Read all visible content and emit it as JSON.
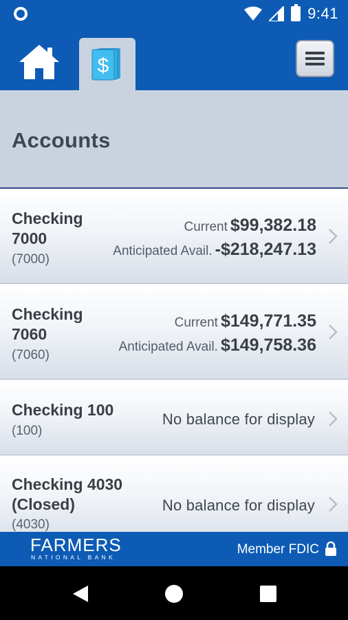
{
  "status_bar": {
    "time": "9:41"
  },
  "header": {
    "home_icon": "home-icon",
    "accounts_tab_icon": "dollar-cards-icon",
    "menu_icon": "hamburger-menu-icon"
  },
  "page": {
    "title": "Accounts"
  },
  "accounts": [
    {
      "name_line1": "Checking",
      "name_line2": "7000",
      "number": "(7000)",
      "current_label": "Current",
      "current_value": "$99,382.18",
      "anticipated_label": "Anticipated Avail.",
      "anticipated_value": "-$218,247.13"
    },
    {
      "name_line1": "Checking",
      "name_line2": "7060",
      "number": "(7060)",
      "current_label": "Current",
      "current_value": "$149,771.35",
      "anticipated_label": "Anticipated Avail.",
      "anticipated_value": "$149,758.36"
    },
    {
      "name_line1": "Checking 100",
      "number": "(100)",
      "no_balance": "No balance for display"
    },
    {
      "name_line1": "Checking 4030",
      "name_line2": "(Closed)",
      "number": "(4030)",
      "no_balance": "No balance for display"
    }
  ],
  "footer": {
    "logo_main": "FARMERS",
    "logo_sub": "NATIONAL BANK",
    "fdic": "Member FDIC"
  },
  "colors": {
    "brand_blue": "#0d5bb5",
    "tab_gray": "#c9d3e0",
    "accent_cyan": "#3fb6e8"
  }
}
